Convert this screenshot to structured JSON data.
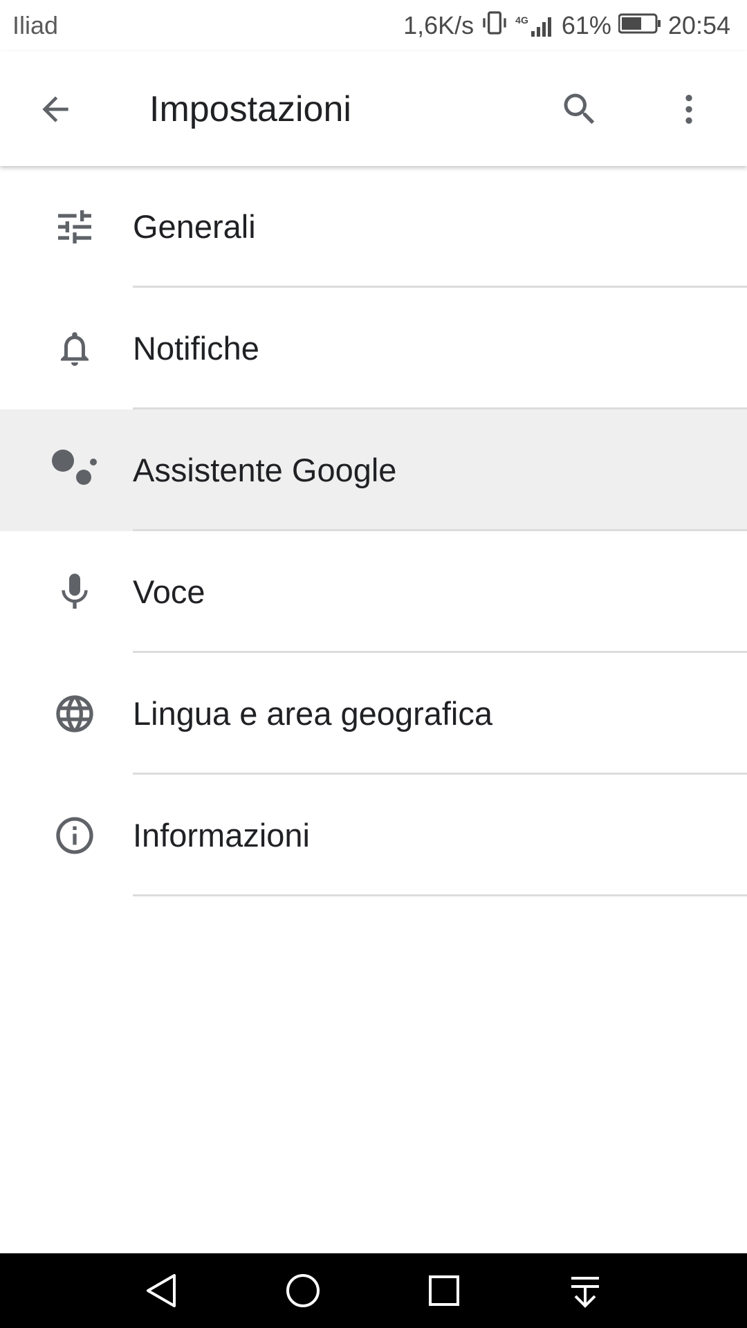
{
  "status_bar": {
    "carrier": "Iliad",
    "net_speed": "1,6K/s",
    "network_type": "4G",
    "battery_percent": "61%",
    "battery_level": 0.61,
    "time": "20:54"
  },
  "toolbar": {
    "title": "Impostazioni",
    "back_icon": "arrow-back-icon",
    "search_icon": "search-icon",
    "more_icon": "more-vert-icon"
  },
  "menu": {
    "items": [
      {
        "label": "Generali",
        "icon": "tune-icon"
      },
      {
        "label": "Notifiche",
        "icon": "bell-icon"
      },
      {
        "label": "Assistente Google",
        "icon": "google-assistant-icon",
        "active": true
      },
      {
        "label": "Voce",
        "icon": "microphone-icon"
      },
      {
        "label": "Lingua e area geografica",
        "icon": "globe-icon"
      },
      {
        "label": "Informazioni",
        "icon": "info-icon"
      }
    ]
  },
  "colors": {
    "icon": "#5f6368",
    "text": "#202124",
    "active_bg": "#efefef",
    "divider": "#dcdcdc"
  }
}
